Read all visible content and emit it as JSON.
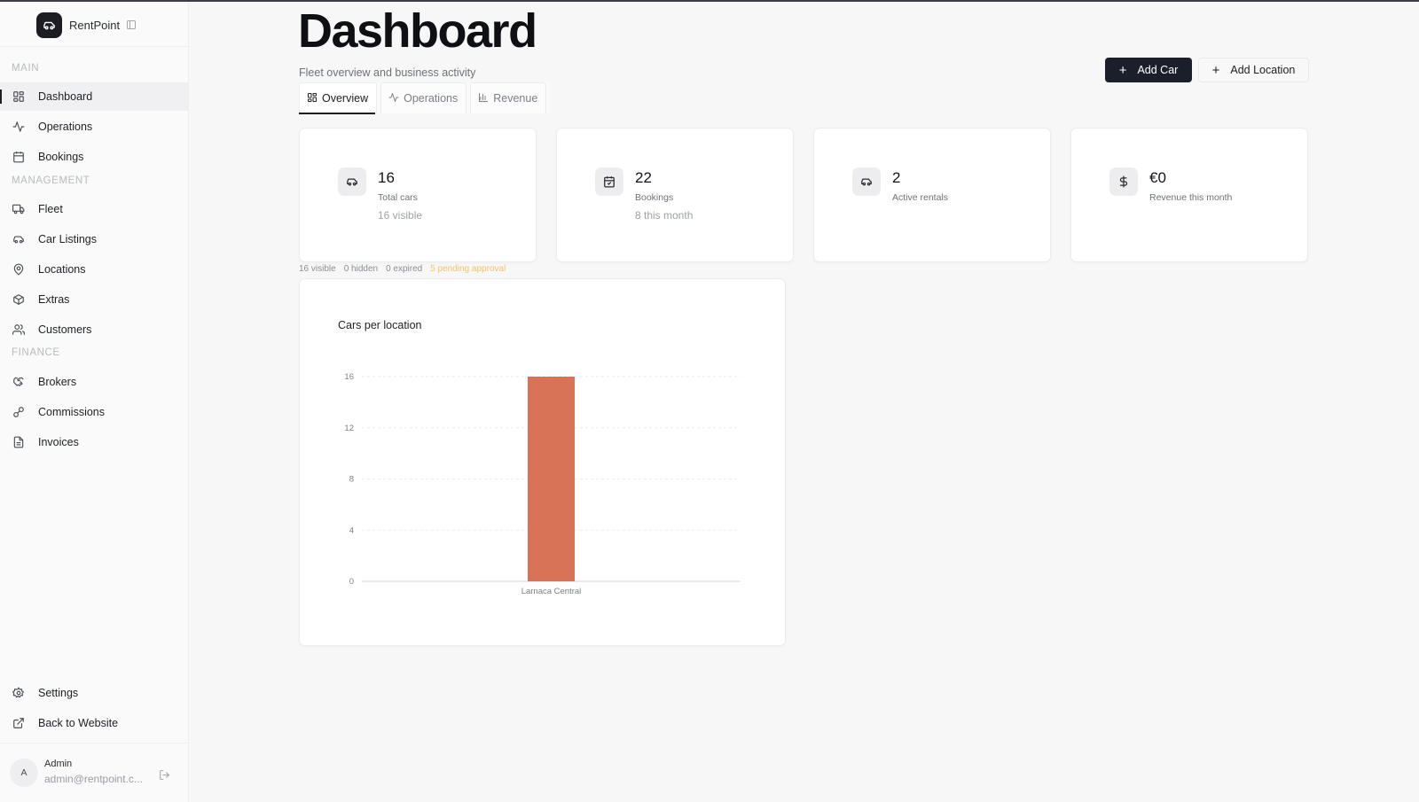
{
  "brand": {
    "name": "RentPoint"
  },
  "sidebar": {
    "sections": [
      "Main",
      "Management",
      "Finance"
    ],
    "main_items": [
      {
        "label": "Dashboard",
        "icon": "grid-icon",
        "active": true
      },
      {
        "label": "Operations",
        "icon": "activity-icon"
      },
      {
        "label": "Bookings",
        "icon": "calendar-icon"
      }
    ],
    "management_items": [
      {
        "label": "Fleet",
        "icon": "truck-icon"
      },
      {
        "label": "Car Listings",
        "icon": "car-icon"
      },
      {
        "label": "Locations",
        "icon": "map-pin-icon"
      },
      {
        "label": "Extras",
        "icon": "box-icon"
      },
      {
        "label": "Customers",
        "icon": "users-icon"
      }
    ],
    "finance_items": [
      {
        "label": "Brokers",
        "icon": "handshake-icon"
      },
      {
        "label": "Commissions",
        "icon": "link-icon"
      },
      {
        "label": "Invoices",
        "icon": "file-icon"
      }
    ],
    "bottom_items": [
      {
        "label": "Settings",
        "icon": "gear-icon"
      },
      {
        "label": "Back to Website",
        "icon": "external-link-icon"
      }
    ]
  },
  "user": {
    "initial": "A",
    "name": "Admin",
    "email": "admin@rentpoint.c..."
  },
  "header": {
    "title": "Dashboard",
    "subtitle": "Fleet overview and business activity",
    "add_car_label": "Add Car",
    "add_location_label": "Add Location"
  },
  "tabs": [
    {
      "label": "Overview",
      "icon": "grid-icon",
      "active": true
    },
    {
      "label": "Operations",
      "icon": "activity-icon"
    },
    {
      "label": "Revenue",
      "icon": "bar-chart-icon"
    }
  ],
  "stats": [
    {
      "value": "16",
      "label": "Total cars",
      "sub": "16 visible",
      "icon": "car-icon"
    },
    {
      "value": "22",
      "label": "Bookings",
      "sub": "8 this month",
      "icon": "calendar-icon"
    },
    {
      "value": "2",
      "label": "Active rentals",
      "sub": "",
      "icon": "car-icon"
    },
    {
      "value": "€0",
      "label": "Revenue this month",
      "sub": "",
      "icon": "dollar-icon"
    }
  ],
  "fleet_status": {
    "visible": "16 visible",
    "hidden": "0 hidden",
    "expired": "0 expired",
    "pending": "5 pending approval"
  },
  "colors": {
    "accent": "#1b1f2a",
    "bar": "#d97357",
    "pending": "#f3c26a"
  },
  "chart_data": {
    "type": "bar",
    "title": "Cars per location",
    "categories": [
      "Larnaca Central"
    ],
    "values": [
      16
    ],
    "ylim": [
      0,
      16
    ],
    "yticks": [
      0,
      4,
      8,
      12,
      16
    ],
    "grid": true
  }
}
